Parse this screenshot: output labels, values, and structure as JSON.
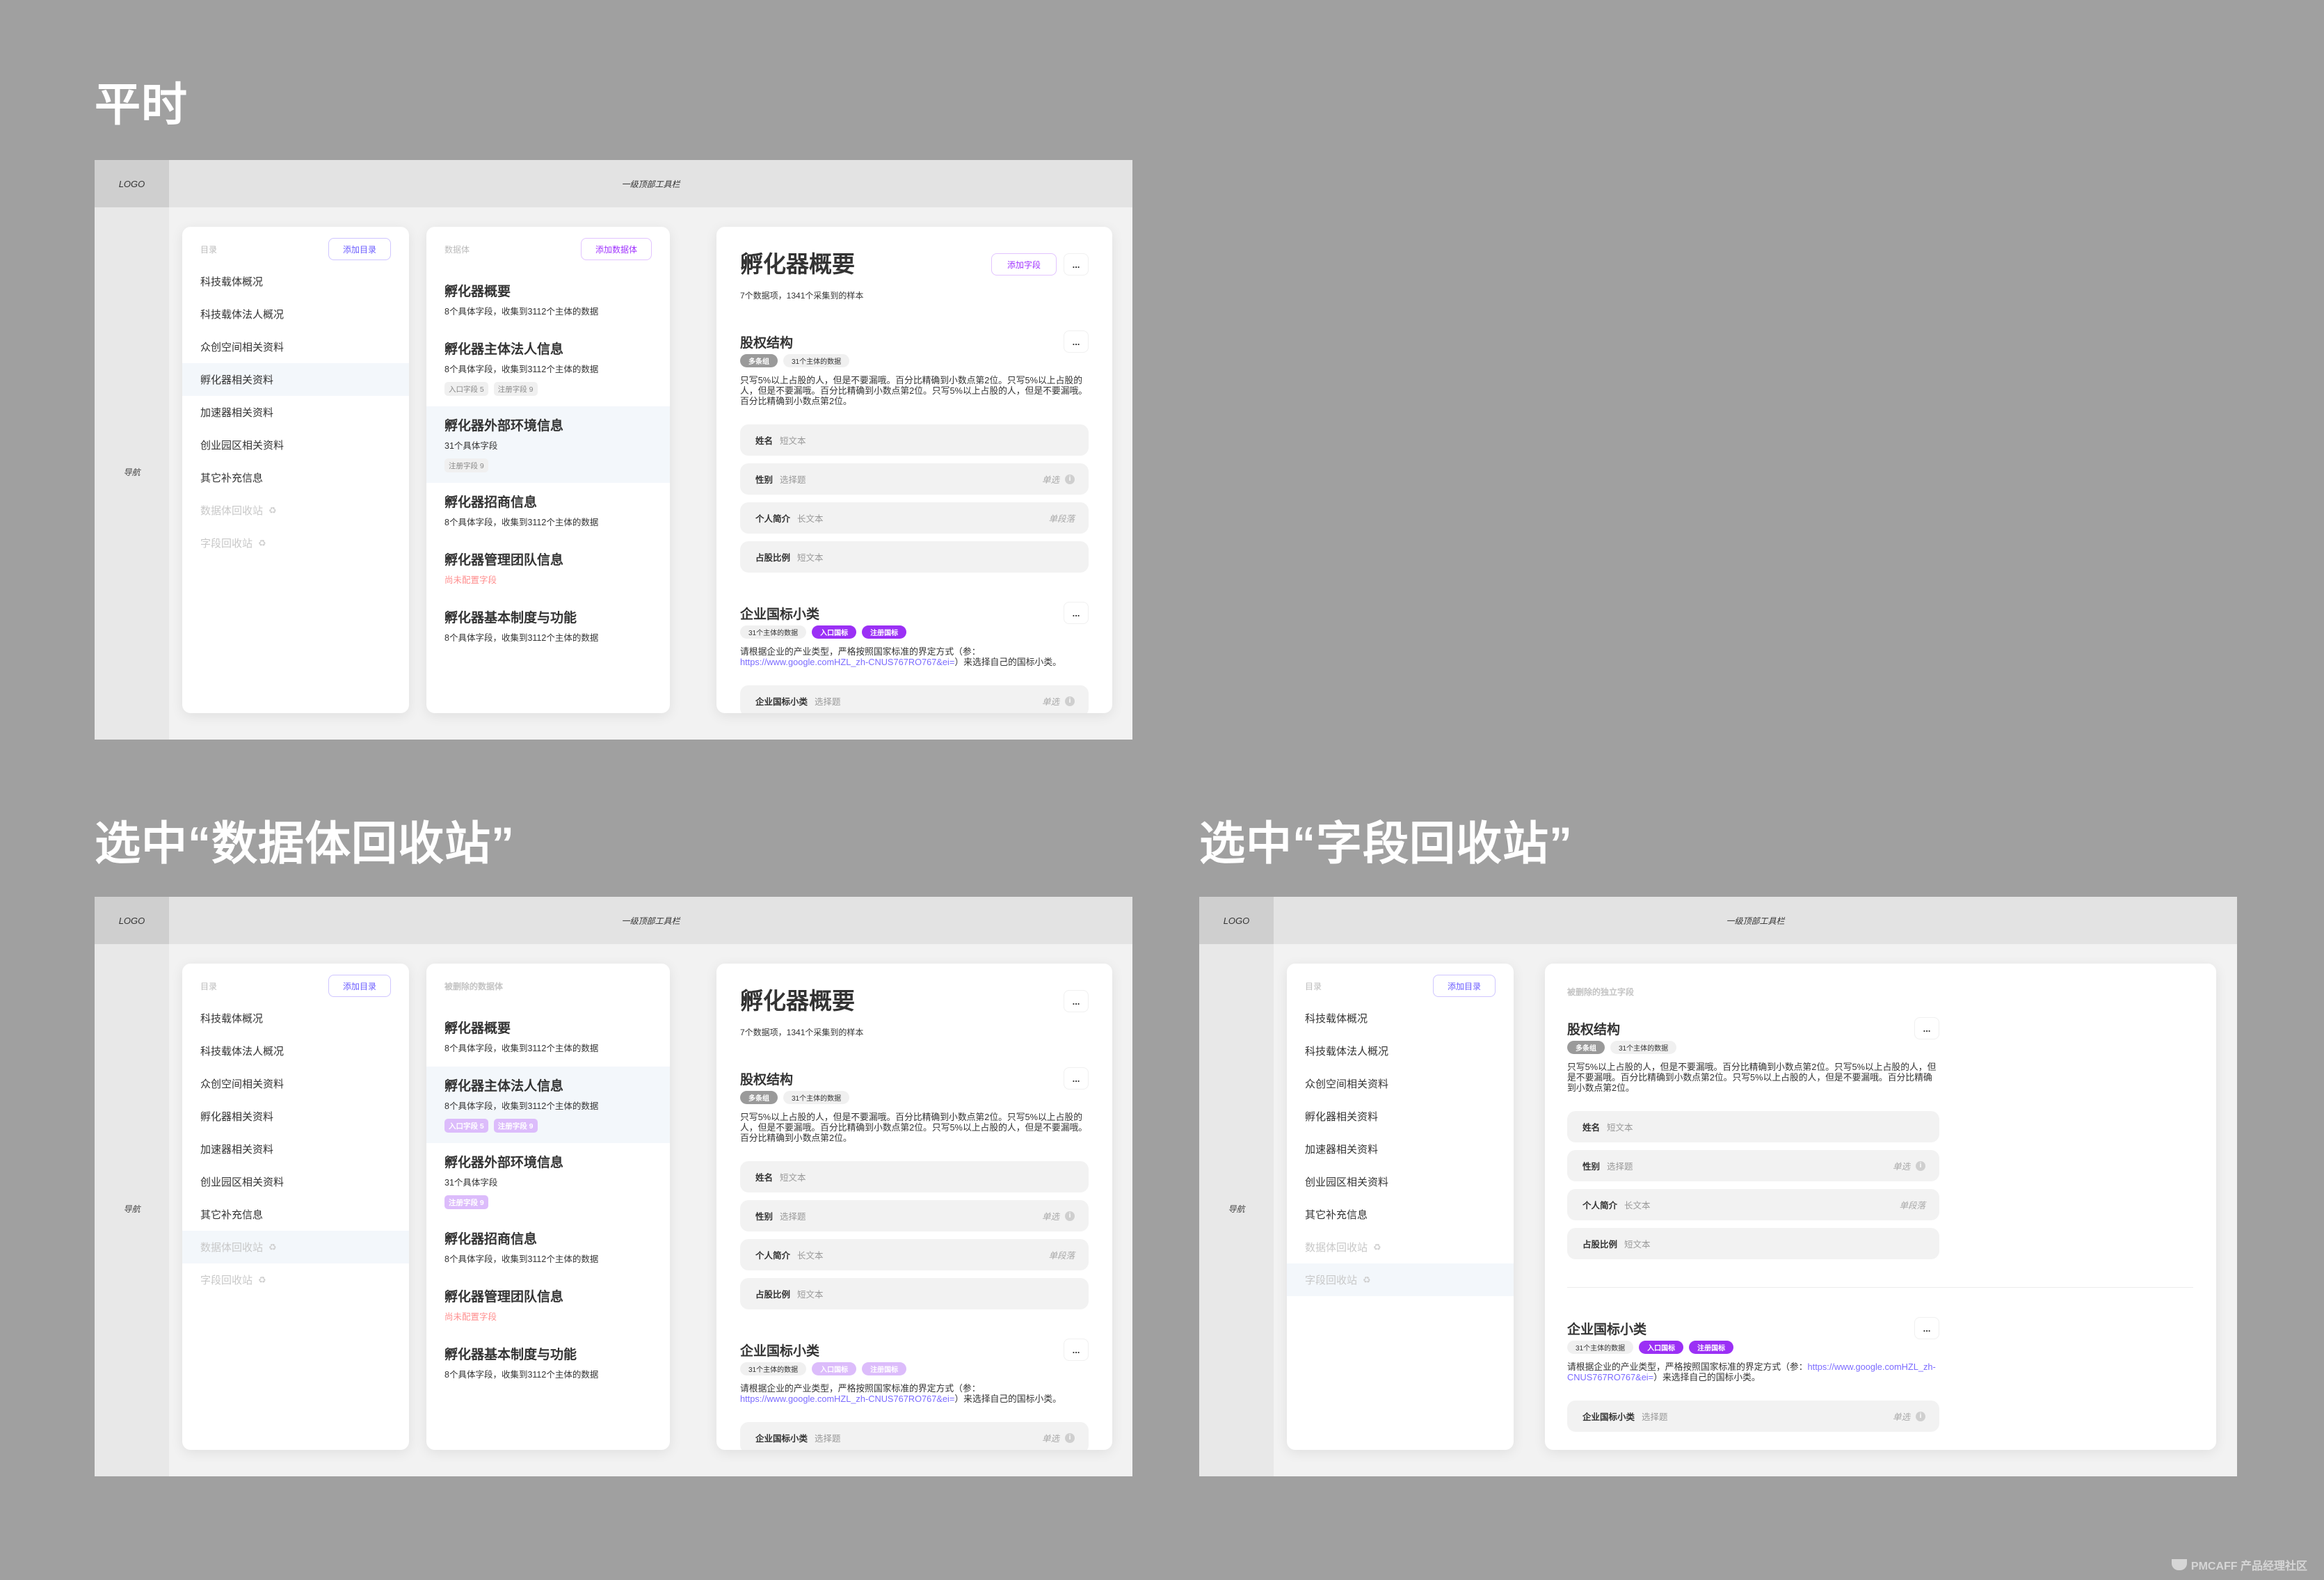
{
  "watermark": "PMCAFF 产品经理社区",
  "app": {
    "logo": "LOGO",
    "toolbar": "一级顶部工具栏",
    "nav": "导航"
  },
  "colors": {
    "accent": "#9b30f5",
    "accent_faded": "#dcbcfb",
    "link": "#7b6bff",
    "warning": "#ff8e8e",
    "selected_row": "#f3f7fb",
    "page_bg": "#a0a0a0"
  },
  "catalog": {
    "label": "目录",
    "add_button": "添加目录",
    "items": [
      "科技载体概况",
      "科技载体法人概况",
      "众创空间相关资料",
      "孵化器相关资料",
      "加速器相关资料",
      "创业园区相关资料",
      "其它补充信息"
    ],
    "recycle": [
      {
        "label": "数据体回收站",
        "icon": "recycle-icon"
      },
      {
        "label": "字段回收站",
        "icon": "recycle-icon"
      }
    ]
  },
  "datasets": {
    "label": "数据体",
    "deleted_label": "被删除的数据体",
    "add_button": "添加数据体",
    "items": [
      {
        "title": "孵化器概要",
        "subtitle": "8个具体字段，收集到3112个主体的数据",
        "tags": []
      },
      {
        "title": "孵化器主体法人信息",
        "subtitle": "8个具体字段，收集到3112个主体的数据",
        "tags": [
          "入口字段 5",
          "注册字段 9"
        ]
      },
      {
        "title": "孵化器外部环境信息",
        "subtitle": "31个具体字段",
        "tags": [
          "注册字段 9"
        ]
      },
      {
        "title": "孵化器招商信息",
        "subtitle": "8个具体字段，收集到3112个主体的数据",
        "tags": []
      },
      {
        "title": "孵化器管理团队信息",
        "subtitle": "尚未配置字段",
        "warning": true,
        "tags": []
      },
      {
        "title": "孵化器基本制度与功能",
        "subtitle": "8个具体字段，收集到3112个主体的数据",
        "tags": []
      }
    ]
  },
  "detail": {
    "title": "孵化器概要",
    "summary": "7个数据项，1341个采集到的样本",
    "add_field": "添加字段",
    "more": "...",
    "deleted_fields_label": "被删除的独立字段",
    "sections": [
      {
        "title": "股权结构",
        "badges": [
          {
            "label": "多条组",
            "kind": "dark"
          },
          {
            "label": "31个主体的数据",
            "kind": "light"
          }
        ],
        "desc": "只写5%以上占股的人，但是不要漏哦。百分比精确到小数点第2位。只写5%以上占股的人，但是不要漏哦。百分比精确到小数点第2位。只写5%以上占股的人，但是不要漏哦。百分比精确到小数点第2位。",
        "fields": [
          {
            "name": "姓名",
            "type": "短文本",
            "mode": ""
          },
          {
            "name": "性别",
            "type": "选择题",
            "mode": "单选",
            "info": true
          },
          {
            "name": "个人简介",
            "type": "长文本",
            "mode": "单段落"
          },
          {
            "name": "占股比例",
            "type": "短文本",
            "mode": ""
          }
        ]
      },
      {
        "title": "企业国标小类",
        "badges": [
          {
            "label": "31个主体的数据",
            "kind": "light"
          },
          {
            "label": "入口国标",
            "kind": "accent"
          },
          {
            "label": "注册国标",
            "kind": "accent"
          }
        ],
        "desc": "请根据企业的产业类型，严格按照国家标准的界定方式（参：",
        "link": "https://www.google.comHZL_zh-CNUS767RO767&ei=",
        "desc_after": "）来选择自己的国标小类。",
        "fields": [
          {
            "name": "企业国标小类",
            "type": "选择题",
            "mode": "单选",
            "info": true
          }
        ]
      }
    ]
  },
  "panels": [
    {
      "title": "平时",
      "mode": "normal",
      "catalog_selected": 3,
      "dataset_selected": 2
    },
    {
      "title": "选中“数据体回收站”",
      "mode": "dataset-recycle",
      "catalog_selected": 7,
      "dataset_selected": 1
    },
    {
      "title": "选中“字段回收站”",
      "mode": "field-recycle",
      "catalog_selected": 8,
      "dataset_selected": -1
    }
  ]
}
